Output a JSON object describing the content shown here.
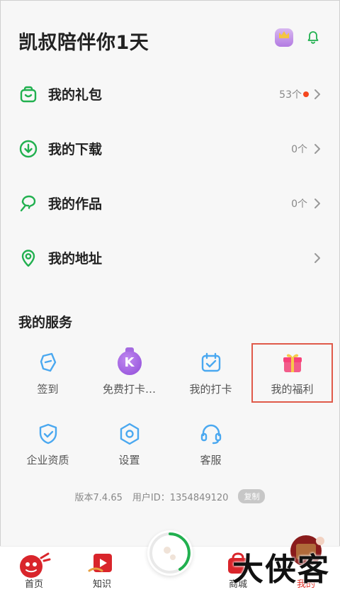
{
  "header": {
    "greeting": "凯叔陪伴你1天",
    "crown_icon": "crown-badge-icon",
    "bell_icon": "bell-icon"
  },
  "menu": {
    "items": [
      {
        "label": "我的礼包",
        "count": "53个",
        "has_dot": true,
        "icon": "gift-bag-icon"
      },
      {
        "label": "我的下载",
        "count": "0个",
        "has_dot": false,
        "icon": "download-icon"
      },
      {
        "label": "我的作品",
        "count": "0个",
        "has_dot": false,
        "icon": "brush-icon"
      },
      {
        "label": "我的地址",
        "count": "",
        "has_dot": false,
        "icon": "location-pin-icon"
      }
    ]
  },
  "services": {
    "title": "我的服务",
    "items": [
      {
        "label": "签到",
        "icon": "tag-icon"
      },
      {
        "label": "免费打卡…",
        "icon": "k-medal-icon"
      },
      {
        "label": "我的打卡",
        "icon": "calendar-check-icon"
      },
      {
        "label": "我的福利",
        "icon": "gift-box-icon"
      },
      {
        "label": "企业资质",
        "icon": "shield-check-icon"
      },
      {
        "label": "设置",
        "icon": "settings-icon"
      },
      {
        "label": "客服",
        "icon": "headset-icon"
      }
    ]
  },
  "version": {
    "version_text": "版本7.4.65",
    "user_id_text": "用户ID：1354849120",
    "copy_label": "复制"
  },
  "nav": {
    "items": [
      {
        "label": "首页"
      },
      {
        "label": "知识"
      },
      {
        "label": "商城"
      },
      {
        "label": "我的"
      }
    ]
  },
  "watermark": "大侠客",
  "colors": {
    "accent_green": "#21b04f",
    "accent_blue": "#4aa8f0",
    "dot_red": "#f5471f",
    "highlight_red": "#e05a4a"
  }
}
